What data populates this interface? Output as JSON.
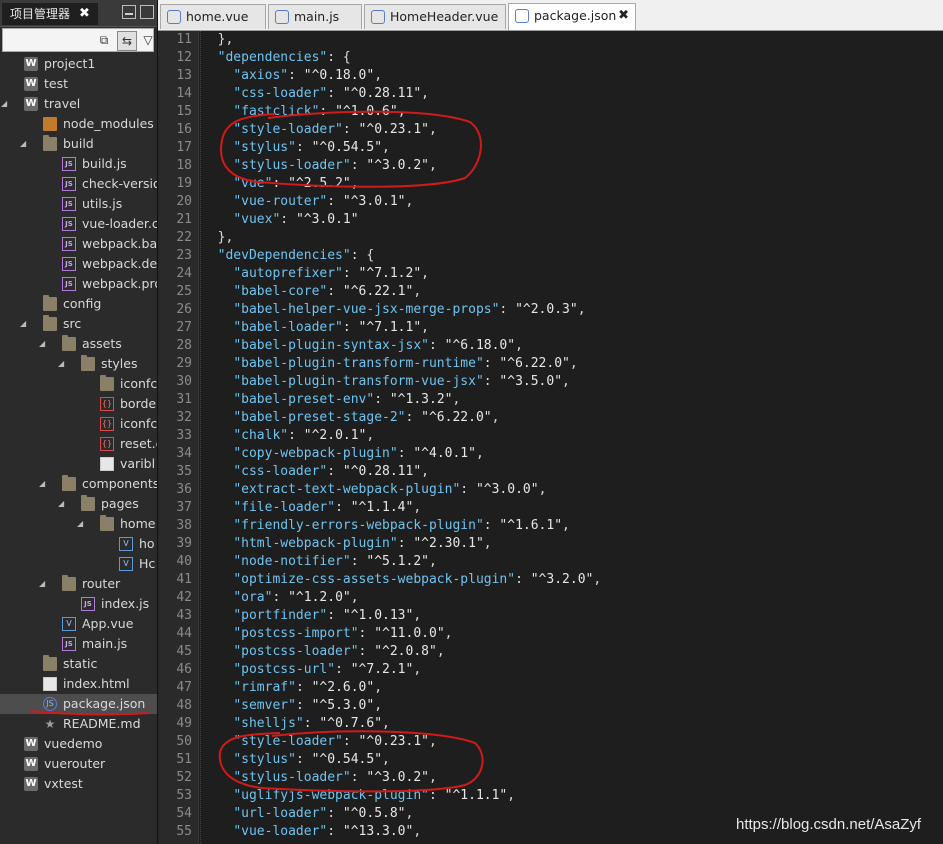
{
  "panel": {
    "title": "项目管理器",
    "close_glyph": "✖"
  },
  "tree": [
    {
      "label": "project1",
      "icon": "w-project-icon",
      "depth": 0,
      "twisty": ""
    },
    {
      "label": "test",
      "icon": "w-project-icon",
      "depth": 0,
      "twisty": ""
    },
    {
      "label": "travel",
      "icon": "w-project-icon",
      "depth": 0,
      "twisty": "open"
    },
    {
      "label": "node_modules",
      "icon": "node-modules-icon",
      "depth": 1,
      "twisty": ""
    },
    {
      "label": "build",
      "icon": "folder-icon",
      "depth": 1,
      "twisty": "open"
    },
    {
      "label": "build.js",
      "icon": "js-file-icon",
      "depth": 2,
      "twisty": ""
    },
    {
      "label": "check-versio",
      "icon": "js-file-icon",
      "depth": 2,
      "twisty": ""
    },
    {
      "label": "utils.js",
      "icon": "js-file-icon",
      "depth": 2,
      "twisty": ""
    },
    {
      "label": "vue-loader.c",
      "icon": "js-file-icon",
      "depth": 2,
      "twisty": ""
    },
    {
      "label": "webpack.bas",
      "icon": "js-file-icon",
      "depth": 2,
      "twisty": ""
    },
    {
      "label": "webpack.dev",
      "icon": "js-file-icon",
      "depth": 2,
      "twisty": ""
    },
    {
      "label": "webpack.pro",
      "icon": "js-file-icon",
      "depth": 2,
      "twisty": ""
    },
    {
      "label": "config",
      "icon": "folder-icon",
      "depth": 1,
      "twisty": ""
    },
    {
      "label": "src",
      "icon": "folder-icon",
      "depth": 1,
      "twisty": "open"
    },
    {
      "label": "assets",
      "icon": "folder-icon",
      "depth": 2,
      "twisty": "open"
    },
    {
      "label": "styles",
      "icon": "folder-icon",
      "depth": 3,
      "twisty": "open"
    },
    {
      "label": "iconfc",
      "icon": "folder-icon",
      "depth": 4,
      "twisty": ""
    },
    {
      "label": "borde",
      "icon": "css-file-icon",
      "depth": 4,
      "twisty": ""
    },
    {
      "label": "iconfc",
      "icon": "css-file-icon",
      "depth": 4,
      "twisty": ""
    },
    {
      "label": "reset.c",
      "icon": "css-file-icon",
      "depth": 4,
      "twisty": ""
    },
    {
      "label": "varibl",
      "icon": "file-icon",
      "depth": 4,
      "twisty": ""
    },
    {
      "label": "components",
      "icon": "folder-icon",
      "depth": 2,
      "twisty": "open"
    },
    {
      "label": "pages",
      "icon": "folder-icon",
      "depth": 3,
      "twisty": "open"
    },
    {
      "label": "home",
      "icon": "folder-icon",
      "depth": 4,
      "twisty": "open"
    },
    {
      "label": "ho",
      "icon": "vue-file-icon",
      "depth": 5,
      "twisty": ""
    },
    {
      "label": "Hc",
      "icon": "vue-file-icon",
      "depth": 5,
      "twisty": ""
    },
    {
      "label": "router",
      "icon": "folder-icon",
      "depth": 2,
      "twisty": "open"
    },
    {
      "label": "index.js",
      "icon": "js-file-icon",
      "depth": 3,
      "twisty": ""
    },
    {
      "label": "App.vue",
      "icon": "vue-file-icon",
      "depth": 2,
      "twisty": ""
    },
    {
      "label": "main.js",
      "icon": "js-file-icon",
      "depth": 2,
      "twisty": ""
    },
    {
      "label": "static",
      "icon": "folder-icon",
      "depth": 1,
      "twisty": ""
    },
    {
      "label": "index.html",
      "icon": "file-icon",
      "depth": 1,
      "twisty": ""
    },
    {
      "label": "package.json",
      "icon": "json-file-icon",
      "depth": 1,
      "twisty": "",
      "selected": true
    },
    {
      "label": "README.md",
      "icon": "star-file-icon",
      "depth": 1,
      "twisty": ""
    },
    {
      "label": "vuedemo",
      "icon": "w-project-icon",
      "depth": 0,
      "twisty": ""
    },
    {
      "label": "vuerouter",
      "icon": "w-project-icon",
      "depth": 0,
      "twisty": ""
    },
    {
      "label": "vxtest",
      "icon": "w-project-icon",
      "depth": 0,
      "twisty": ""
    }
  ],
  "tabs": [
    {
      "label": "home.vue",
      "active": false
    },
    {
      "label": "main.js",
      "active": false
    },
    {
      "label": "HomeHeader.vue",
      "active": false
    },
    {
      "label": "package.json",
      "active": true,
      "close": "✖"
    }
  ],
  "editor": {
    "first_line": 11,
    "lines": [
      {
        "indent": "  ",
        "text": [
          [
            "p",
            "},"
          ]
        ]
      },
      {
        "indent": "  ",
        "text": [
          [
            "k",
            "\"dependencies\""
          ],
          [
            "p",
            ": {"
          ]
        ]
      },
      {
        "indent": "    ",
        "text": [
          [
            "k",
            "\"axios\""
          ],
          [
            "p",
            ": "
          ],
          [
            "v",
            "\"^0.18.0\""
          ],
          [
            "p",
            ","
          ]
        ]
      },
      {
        "indent": "    ",
        "text": [
          [
            "k",
            "\"css-loader\""
          ],
          [
            "p",
            ": "
          ],
          [
            "v",
            "\"^0.28.11\""
          ],
          [
            "p",
            ","
          ]
        ]
      },
      {
        "indent": "    ",
        "text": [
          [
            "k",
            "\"fastclick\""
          ],
          [
            "p",
            ": "
          ],
          [
            "v",
            "\"^1.0.6\""
          ],
          [
            "p",
            ","
          ]
        ]
      },
      {
        "indent": "    ",
        "text": [
          [
            "k",
            "\"style-loader\""
          ],
          [
            "p",
            ": "
          ],
          [
            "v",
            "\"^0.23.1\""
          ],
          [
            "p",
            ","
          ]
        ]
      },
      {
        "indent": "    ",
        "text": [
          [
            "k",
            "\"stylus\""
          ],
          [
            "p",
            ": "
          ],
          [
            "v",
            "\"^0.54.5\""
          ],
          [
            "p",
            ","
          ]
        ]
      },
      {
        "indent": "    ",
        "text": [
          [
            "k",
            "\"stylus-loader\""
          ],
          [
            "p",
            ": "
          ],
          [
            "v",
            "\"^3.0.2\""
          ],
          [
            "p",
            ","
          ]
        ]
      },
      {
        "indent": "    ",
        "text": [
          [
            "k",
            "\"vue\""
          ],
          [
            "p",
            ": "
          ],
          [
            "v",
            "\"^2.5.2\""
          ],
          [
            "p",
            ","
          ]
        ]
      },
      {
        "indent": "    ",
        "text": [
          [
            "k",
            "\"vue-router\""
          ],
          [
            "p",
            ": "
          ],
          [
            "v",
            "\"^3.0.1\""
          ],
          [
            "p",
            ","
          ]
        ]
      },
      {
        "indent": "    ",
        "text": [
          [
            "k",
            "\"vuex\""
          ],
          [
            "p",
            ": "
          ],
          [
            "v",
            "\"^3.0.1\""
          ]
        ]
      },
      {
        "indent": "  ",
        "text": [
          [
            "p",
            "},"
          ]
        ]
      },
      {
        "indent": "  ",
        "text": [
          [
            "k",
            "\"devDependencies\""
          ],
          [
            "p",
            ": {"
          ]
        ]
      },
      {
        "indent": "    ",
        "text": [
          [
            "k",
            "\"autoprefixer\""
          ],
          [
            "p",
            ": "
          ],
          [
            "v",
            "\"^7.1.2\""
          ],
          [
            "p",
            ","
          ]
        ]
      },
      {
        "indent": "    ",
        "text": [
          [
            "k",
            "\"babel-core\""
          ],
          [
            "p",
            ": "
          ],
          [
            "v",
            "\"^6.22.1\""
          ],
          [
            "p",
            ","
          ]
        ]
      },
      {
        "indent": "    ",
        "text": [
          [
            "k",
            "\"babel-helper-vue-jsx-merge-props\""
          ],
          [
            "p",
            ": "
          ],
          [
            "v",
            "\"^2.0.3\""
          ],
          [
            "p",
            ","
          ]
        ]
      },
      {
        "indent": "    ",
        "text": [
          [
            "k",
            "\"babel-loader\""
          ],
          [
            "p",
            ": "
          ],
          [
            "v",
            "\"^7.1.1\""
          ],
          [
            "p",
            ","
          ]
        ]
      },
      {
        "indent": "    ",
        "text": [
          [
            "k",
            "\"babel-plugin-syntax-jsx\""
          ],
          [
            "p",
            ": "
          ],
          [
            "v",
            "\"^6.18.0\""
          ],
          [
            "p",
            ","
          ]
        ]
      },
      {
        "indent": "    ",
        "text": [
          [
            "k",
            "\"babel-plugin-transform-runtime\""
          ],
          [
            "p",
            ": "
          ],
          [
            "v",
            "\"^6.22.0\""
          ],
          [
            "p",
            ","
          ]
        ]
      },
      {
        "indent": "    ",
        "text": [
          [
            "k",
            "\"babel-plugin-transform-vue-jsx\""
          ],
          [
            "p",
            ": "
          ],
          [
            "v",
            "\"^3.5.0\""
          ],
          [
            "p",
            ","
          ]
        ]
      },
      {
        "indent": "    ",
        "text": [
          [
            "k",
            "\"babel-preset-env\""
          ],
          [
            "p",
            ": "
          ],
          [
            "v",
            "\"^1.3.2\""
          ],
          [
            "p",
            ","
          ]
        ]
      },
      {
        "indent": "    ",
        "text": [
          [
            "k",
            "\"babel-preset-stage-2\""
          ],
          [
            "p",
            ": "
          ],
          [
            "v",
            "\"^6.22.0\""
          ],
          [
            "p",
            ","
          ]
        ]
      },
      {
        "indent": "    ",
        "text": [
          [
            "k",
            "\"chalk\""
          ],
          [
            "p",
            ": "
          ],
          [
            "v",
            "\"^2.0.1\""
          ],
          [
            "p",
            ","
          ]
        ]
      },
      {
        "indent": "    ",
        "text": [
          [
            "k",
            "\"copy-webpack-plugin\""
          ],
          [
            "p",
            ": "
          ],
          [
            "v",
            "\"^4.0.1\""
          ],
          [
            "p",
            ","
          ]
        ]
      },
      {
        "indent": "    ",
        "text": [
          [
            "k",
            "\"css-loader\""
          ],
          [
            "p",
            ": "
          ],
          [
            "v",
            "\"^0.28.11\""
          ],
          [
            "p",
            ","
          ]
        ]
      },
      {
        "indent": "    ",
        "text": [
          [
            "k",
            "\"extract-text-webpack-plugin\""
          ],
          [
            "p",
            ": "
          ],
          [
            "v",
            "\"^3.0.0\""
          ],
          [
            "p",
            ","
          ]
        ]
      },
      {
        "indent": "    ",
        "text": [
          [
            "k",
            "\"file-loader\""
          ],
          [
            "p",
            ": "
          ],
          [
            "v",
            "\"^1.1.4\""
          ],
          [
            "p",
            ","
          ]
        ]
      },
      {
        "indent": "    ",
        "text": [
          [
            "k",
            "\"friendly-errors-webpack-plugin\""
          ],
          [
            "p",
            ": "
          ],
          [
            "v",
            "\"^1.6.1\""
          ],
          [
            "p",
            ","
          ]
        ]
      },
      {
        "indent": "    ",
        "text": [
          [
            "k",
            "\"html-webpack-plugin\""
          ],
          [
            "p",
            ": "
          ],
          [
            "v",
            "\"^2.30.1\""
          ],
          [
            "p",
            ","
          ]
        ]
      },
      {
        "indent": "    ",
        "text": [
          [
            "k",
            "\"node-notifier\""
          ],
          [
            "p",
            ": "
          ],
          [
            "v",
            "\"^5.1.2\""
          ],
          [
            "p",
            ","
          ]
        ]
      },
      {
        "indent": "    ",
        "text": [
          [
            "k",
            "\"optimize-css-assets-webpack-plugin\""
          ],
          [
            "p",
            ": "
          ],
          [
            "v",
            "\"^3.2.0\""
          ],
          [
            "p",
            ","
          ]
        ]
      },
      {
        "indent": "    ",
        "text": [
          [
            "k",
            "\"ora\""
          ],
          [
            "p",
            ": "
          ],
          [
            "v",
            "\"^1.2.0\""
          ],
          [
            "p",
            ","
          ]
        ]
      },
      {
        "indent": "    ",
        "text": [
          [
            "k",
            "\"portfinder\""
          ],
          [
            "p",
            ": "
          ],
          [
            "v",
            "\"^1.0.13\""
          ],
          [
            "p",
            ","
          ]
        ]
      },
      {
        "indent": "    ",
        "text": [
          [
            "k",
            "\"postcss-import\""
          ],
          [
            "p",
            ": "
          ],
          [
            "v",
            "\"^11.0.0\""
          ],
          [
            "p",
            ","
          ]
        ]
      },
      {
        "indent": "    ",
        "text": [
          [
            "k",
            "\"postcss-loader\""
          ],
          [
            "p",
            ": "
          ],
          [
            "v",
            "\"^2.0.8\""
          ],
          [
            "p",
            ","
          ]
        ]
      },
      {
        "indent": "    ",
        "text": [
          [
            "k",
            "\"postcss-url\""
          ],
          [
            "p",
            ": "
          ],
          [
            "v",
            "\"^7.2.1\""
          ],
          [
            "p",
            ","
          ]
        ]
      },
      {
        "indent": "    ",
        "text": [
          [
            "k",
            "\"rimraf\""
          ],
          [
            "p",
            ": "
          ],
          [
            "v",
            "\"^2.6.0\""
          ],
          [
            "p",
            ","
          ]
        ]
      },
      {
        "indent": "    ",
        "text": [
          [
            "k",
            "\"semver\""
          ],
          [
            "p",
            ": "
          ],
          [
            "v",
            "\"^5.3.0\""
          ],
          [
            "p",
            ","
          ]
        ]
      },
      {
        "indent": "    ",
        "text": [
          [
            "k",
            "\"shelljs\""
          ],
          [
            "p",
            ": "
          ],
          [
            "v",
            "\"^0.7.6\""
          ],
          [
            "p",
            ","
          ]
        ]
      },
      {
        "indent": "    ",
        "text": [
          [
            "k",
            "\"style-loader\""
          ],
          [
            "p",
            ": "
          ],
          [
            "v",
            "\"^0.23.1\""
          ],
          [
            "p",
            ","
          ]
        ]
      },
      {
        "indent": "    ",
        "text": [
          [
            "k",
            "\"stylus\""
          ],
          [
            "p",
            ": "
          ],
          [
            "v",
            "\"^0.54.5\""
          ],
          [
            "p",
            ","
          ]
        ]
      },
      {
        "indent": "    ",
        "text": [
          [
            "k",
            "\"stylus-loader\""
          ],
          [
            "p",
            ": "
          ],
          [
            "v",
            "\"^3.0.2\""
          ],
          [
            "p",
            ","
          ]
        ]
      },
      {
        "indent": "    ",
        "text": [
          [
            "k",
            "\"uglifyjs-webpack-plugin\""
          ],
          [
            "p",
            ": "
          ],
          [
            "v",
            "\"^1.1.1\""
          ],
          [
            "p",
            ","
          ]
        ]
      },
      {
        "indent": "    ",
        "text": [
          [
            "k",
            "\"url-loader\""
          ],
          [
            "p",
            ": "
          ],
          [
            "v",
            "\"^0.5.8\""
          ],
          [
            "p",
            ","
          ]
        ]
      },
      {
        "indent": "    ",
        "text": [
          [
            "k",
            "\"vue-loader\""
          ],
          [
            "p",
            ": "
          ],
          [
            "v",
            "\"^13.3.0\""
          ],
          [
            "p",
            ","
          ]
        ]
      }
    ]
  },
  "watermark": "https://blog.csdn.net/AsaZyf",
  "colors": {
    "annotation": "#d11a1a",
    "key": "#6fc3ef",
    "editor_bg": "#1e1e1e"
  }
}
